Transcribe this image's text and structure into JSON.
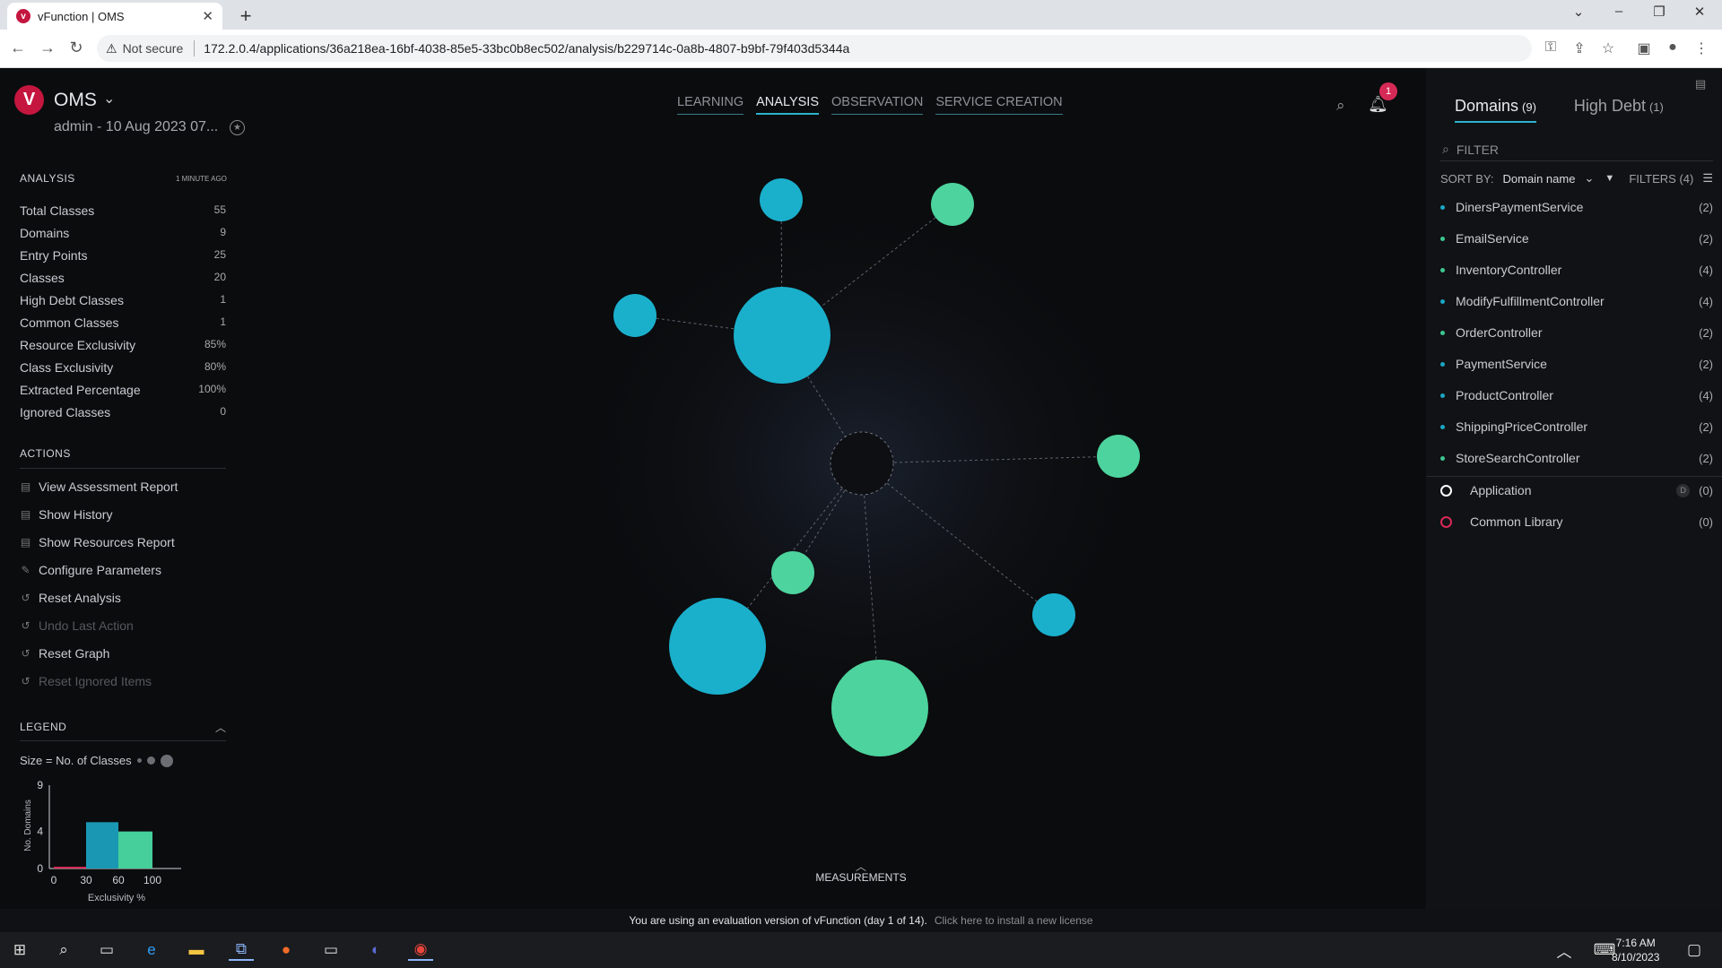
{
  "browser": {
    "tab_title": "vFunction | OMS",
    "tab_favicon": "v",
    "not_secure": "Not secure",
    "url": "172.2.0.4/applications/36a218ea-16bf-4038-85e5-33bc0b8ec502/analysis/b229714c-0a8b-4807-b9bf-79f403d5344a"
  },
  "header": {
    "logo": "V",
    "app_name": "OMS",
    "subtitle": "admin - 10 Aug 2023 07...",
    "nav": [
      "LEARNING",
      "ANALYSIS",
      "OBSERVATION",
      "SERVICE CREATION"
    ],
    "notification_count": "1"
  },
  "analysis": {
    "title": "ANALYSIS",
    "updated": "1 MINUTE AGO",
    "stats": [
      {
        "label": "Total Classes",
        "value": "55"
      },
      {
        "label": "Domains",
        "value": "9"
      },
      {
        "label": "Entry Points",
        "value": "25"
      },
      {
        "label": "Classes",
        "value": "20"
      },
      {
        "label": "High Debt Classes",
        "value": "1"
      },
      {
        "label": "Common Classes",
        "value": "1"
      },
      {
        "label": "Resource Exclusivity",
        "value": "85%"
      },
      {
        "label": "Class Exclusivity",
        "value": "80%"
      },
      {
        "label": "Extracted Percentage",
        "value": "100%"
      },
      {
        "label": "Ignored Classes",
        "value": "0"
      }
    ]
  },
  "actions": {
    "title": "ACTIONS",
    "items": [
      {
        "label": "View Assessment Report",
        "icon": "report-icon"
      },
      {
        "label": "Show History",
        "icon": "history-icon"
      },
      {
        "label": "Show Resources Report",
        "icon": "report-icon"
      },
      {
        "label": "Configure Parameters",
        "icon": "pencil-icon"
      },
      {
        "label": "Reset Analysis",
        "icon": "reset-icon"
      },
      {
        "label": "Undo Last Action",
        "icon": "undo-icon"
      },
      {
        "label": "Reset Graph",
        "icon": "reset-icon"
      },
      {
        "label": "Reset Ignored Items",
        "icon": "reset-icon"
      }
    ]
  },
  "legend": {
    "title": "LEGEND",
    "size_label": "Size = No. of Classes",
    "chart_data": {
      "type": "bar",
      "xlabel": "Exclusivity %",
      "ylabel": "No. Domains",
      "x_ticks": [
        "0",
        "30",
        "60",
        "100"
      ],
      "y_ticks": [
        "9",
        "4",
        "0"
      ],
      "ylim": [
        0,
        9
      ],
      "bins": [
        {
          "from": 0,
          "to": 30,
          "value": 0.1,
          "color": "#d62a56"
        },
        {
          "from": 30,
          "to": 60,
          "value": 5,
          "color": "#1a98b3"
        },
        {
          "from": 60,
          "to": 100,
          "value": 4,
          "color": "#46cf9a"
        }
      ]
    }
  },
  "graph": {
    "measurements_label": "MEASUREMENTS",
    "colors": {
      "blue": "#1ab0cc",
      "green": "#4dd39d"
    }
  },
  "sidebar": {
    "tabs": [
      {
        "label": "Domains",
        "count": "(9)"
      },
      {
        "label": "High Debt",
        "count": "(1)"
      }
    ],
    "filter_placeholder": "FILTER",
    "sort_label": "SORT BY:",
    "sort_value": "Domain name",
    "filters_label": "FILTERS (4)",
    "domains": [
      {
        "name": "DinersPaymentService",
        "count": "(2)",
        "color": "#1aa7c3"
      },
      {
        "name": "EmailService",
        "count": "(2)",
        "color": "#3cc890"
      },
      {
        "name": "InventoryController",
        "count": "(4)",
        "color": "#3cc890"
      },
      {
        "name": "ModifyFulfillmentController",
        "count": "(4)",
        "color": "#1aa7c3"
      },
      {
        "name": "OrderController",
        "count": "(2)",
        "color": "#3cc890"
      },
      {
        "name": "PaymentService",
        "count": "(2)",
        "color": "#1aa7c3"
      },
      {
        "name": "ProductController",
        "count": "(4)",
        "color": "#1aa7c3"
      },
      {
        "name": "ShippingPriceController",
        "count": "(2)",
        "color": "#1aa7c3"
      },
      {
        "name": "StoreSearchController",
        "count": "(2)",
        "color": "#3cc890"
      }
    ],
    "groups": [
      {
        "name": "Application",
        "count": "(0)",
        "badge": "D",
        "color": "#ffffff"
      },
      {
        "name": "Common Library",
        "count": "(0)",
        "color": "#d62a56"
      }
    ]
  },
  "eval_bar": {
    "message": "You are using an evaluation version of vFunction (day 1 of 14).",
    "link": "Click here to install a new license"
  },
  "taskbar": {
    "time": "7:16 AM",
    "date": "8/10/2023"
  }
}
